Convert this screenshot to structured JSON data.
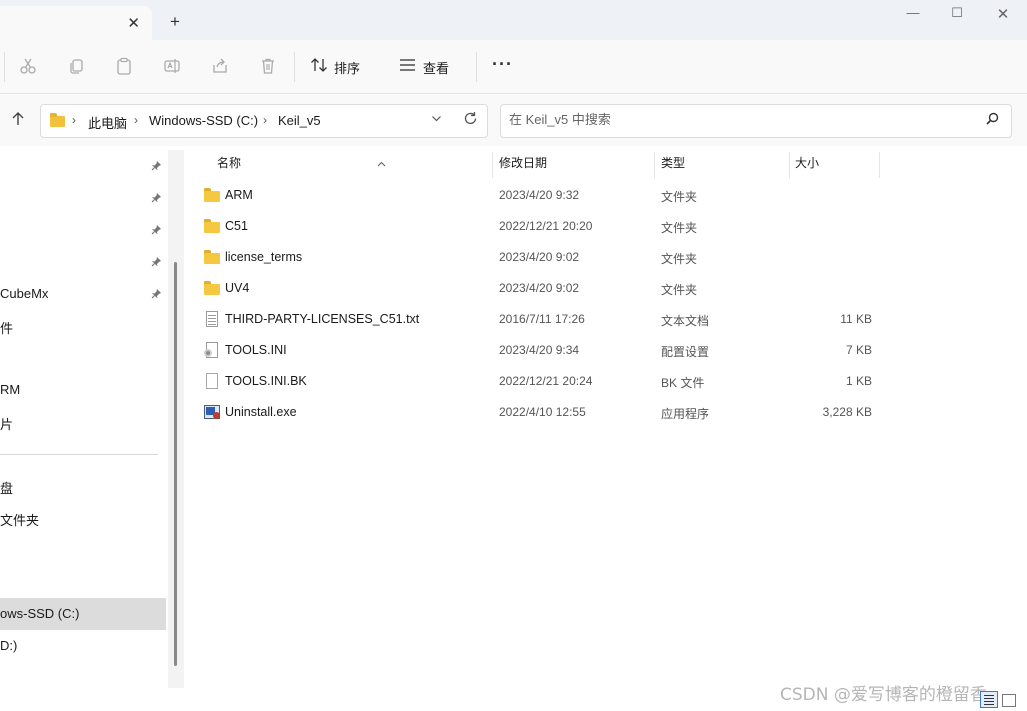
{
  "tab": {
    "close_glyph": "✕",
    "new_tab_glyph": "+"
  },
  "window": {
    "minimize": "—",
    "maximize": "☐",
    "close": "✕"
  },
  "toolbar": {
    "icons": [
      "cut-icon",
      "copy-icon",
      "paste-icon",
      "rename-icon",
      "share-icon",
      "delete-icon"
    ],
    "sort_label": "排序",
    "view_label": "查看",
    "more_label": "···"
  },
  "address": {
    "crumbs": [
      "此电脑",
      "Windows-SSD (C:)",
      "Keil_v5"
    ],
    "separator": "›"
  },
  "search": {
    "placeholder": "在 Keil_v5 中搜索"
  },
  "nav": {
    "items": [
      "CubeMx",
      "件",
      "RM",
      "片",
      "盘",
      "文件夹",
      "ows-SSD (C:)",
      "D:)"
    ],
    "selected": "ows-SSD (C:)"
  },
  "columns": {
    "name": "名称",
    "date": "修改日期",
    "type": "类型",
    "size": "大小"
  },
  "files": [
    {
      "name": "ARM",
      "date": "2023/4/20 9:32",
      "type": "文件夹",
      "size": "",
      "icon": "folder-icon"
    },
    {
      "name": "C51",
      "date": "2022/12/21 20:20",
      "type": "文件夹",
      "size": "",
      "icon": "folder-icon"
    },
    {
      "name": "license_terms",
      "date": "2023/4/20 9:02",
      "type": "文件夹",
      "size": "",
      "icon": "folder-icon"
    },
    {
      "name": "UV4",
      "date": "2023/4/20 9:02",
      "type": "文件夹",
      "size": "",
      "icon": "folder-icon"
    },
    {
      "name": "THIRD-PARTY-LICENSES_C51.txt",
      "date": "2016/7/11 17:26",
      "type": "文本文档",
      "size": "11 KB",
      "icon": "text-file-icon"
    },
    {
      "name": "TOOLS.INI",
      "date": "2023/4/20 9:34",
      "type": "配置设置",
      "size": "7 KB",
      "icon": "settings-file-icon"
    },
    {
      "name": "TOOLS.INI.BK",
      "date": "2022/12/21 20:24",
      "type": "BK 文件",
      "size": "1 KB",
      "icon": "blank-file-icon"
    },
    {
      "name": "Uninstall.exe",
      "date": "2022/4/10 12:55",
      "type": "应用程序",
      "size": "3,228 KB",
      "icon": "application-icon"
    }
  ],
  "watermark": "CSDN @爱写博客的橙留香",
  "colors": {
    "folder": "#f5c842",
    "selection": "#dcdcdc",
    "accent": "#3a78c8"
  }
}
